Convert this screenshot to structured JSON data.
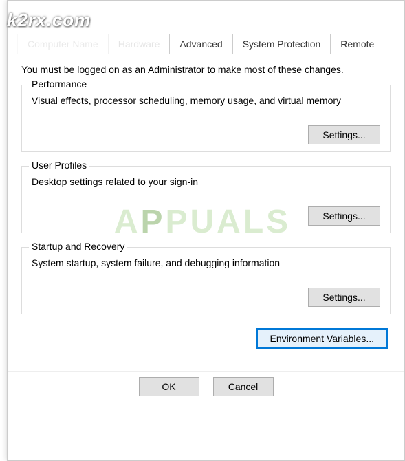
{
  "watermarks": {
    "top": "k2rx.com",
    "center_prefix": "A",
    "center_accent": "P",
    "center_suffix": "PUALS"
  },
  "tabs": {
    "computer_name": "Computer Name",
    "hardware": "Hardware",
    "advanced": "Advanced",
    "system_protection": "System Protection",
    "remote": "Remote"
  },
  "intro": "You must be logged on as an Administrator to make most of these changes.",
  "groups": {
    "performance": {
      "title": "Performance",
      "desc": "Visual effects, processor scheduling, memory usage, and virtual memory",
      "button": "Settings..."
    },
    "user_profiles": {
      "title": "User Profiles",
      "desc": "Desktop settings related to your sign-in",
      "button": "Settings..."
    },
    "startup": {
      "title": "Startup and Recovery",
      "desc": "System startup, system failure, and debugging information",
      "button": "Settings..."
    }
  },
  "env_button": "Environment Variables...",
  "bottom": {
    "ok": "OK",
    "cancel": "Cancel"
  }
}
